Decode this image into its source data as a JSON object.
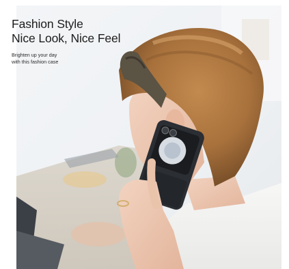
{
  "headline": {
    "line1": "Fashion Style",
    "line2": "Nice Look, Nice Feel"
  },
  "subtext": {
    "line1": "Brighten up your day",
    "line2": "with this fashion case"
  }
}
